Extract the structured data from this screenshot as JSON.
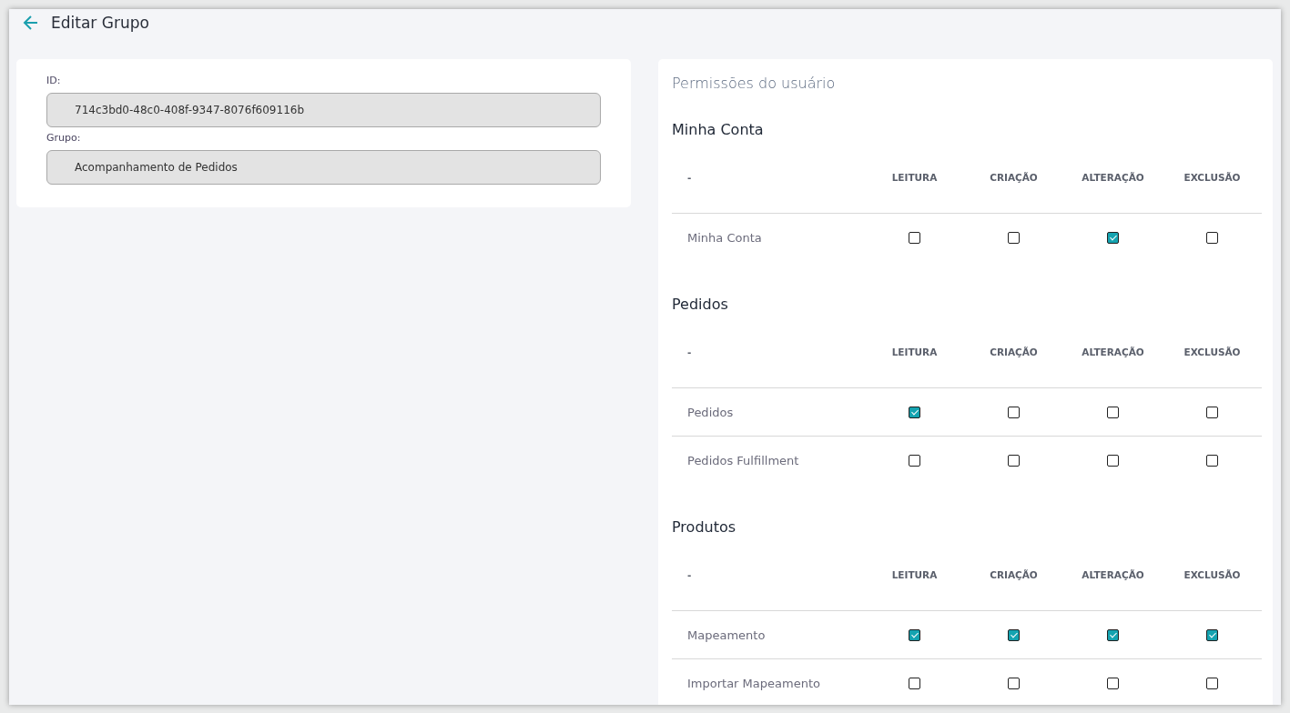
{
  "header": {
    "title": "Editar Grupo"
  },
  "group_form": {
    "fields": [
      {
        "label": "ID:",
        "value": "714c3bd0-48c0-408f-9347-8076f609116b"
      },
      {
        "label": "Grupo:",
        "value": "Acompanhamento de Pedidos"
      }
    ]
  },
  "permissions": {
    "title": "Permissões do usuário",
    "sections": [
      {
        "title": "Minha Conta",
        "columns": [
          "-",
          "LEITURA",
          "CRIAÇÃO",
          "ALTERAÇÃO",
          "EXCLUSÃO"
        ],
        "rows": [
          {
            "name": "Minha Conta",
            "permissions": [
              {
                "checked": false
              },
              {
                "checked": false
              },
              {
                "checked": true
              },
              {
                "checked": false
              }
            ]
          }
        ]
      },
      {
        "title": "Pedidos",
        "columns": [
          "-",
          "LEITURA",
          "CRIAÇÃO",
          "ALTERAÇÃO",
          "EXCLUSÃO"
        ],
        "rows": [
          {
            "name": "Pedidos",
            "permissions": [
              {
                "checked": true
              },
              {
                "checked": false
              },
              {
                "checked": false
              },
              {
                "checked": false
              }
            ]
          },
          {
            "name": "Pedidos Fulfillment",
            "permissions": [
              {
                "checked": false
              },
              {
                "checked": false
              },
              {
                "checked": false
              },
              {
                "checked": false
              }
            ]
          }
        ]
      },
      {
        "title": "Produtos",
        "columns": [
          "-",
          "LEITURA",
          "CRIAÇÃO",
          "ALTERAÇÃO",
          "EXCLUSÃO"
        ],
        "rows": [
          {
            "name": "Mapeamento",
            "permissions": [
              {
                "checked": true
              },
              {
                "checked": true
              },
              {
                "checked": true
              },
              {
                "checked": true
              }
            ]
          },
          {
            "name": "Importar Mapeamento",
            "permissions": [
              {
                "checked": false
              },
              {
                "checked": false
              },
              {
                "checked": false
              },
              {
                "checked": false
              }
            ]
          }
        ]
      }
    ]
  }
}
